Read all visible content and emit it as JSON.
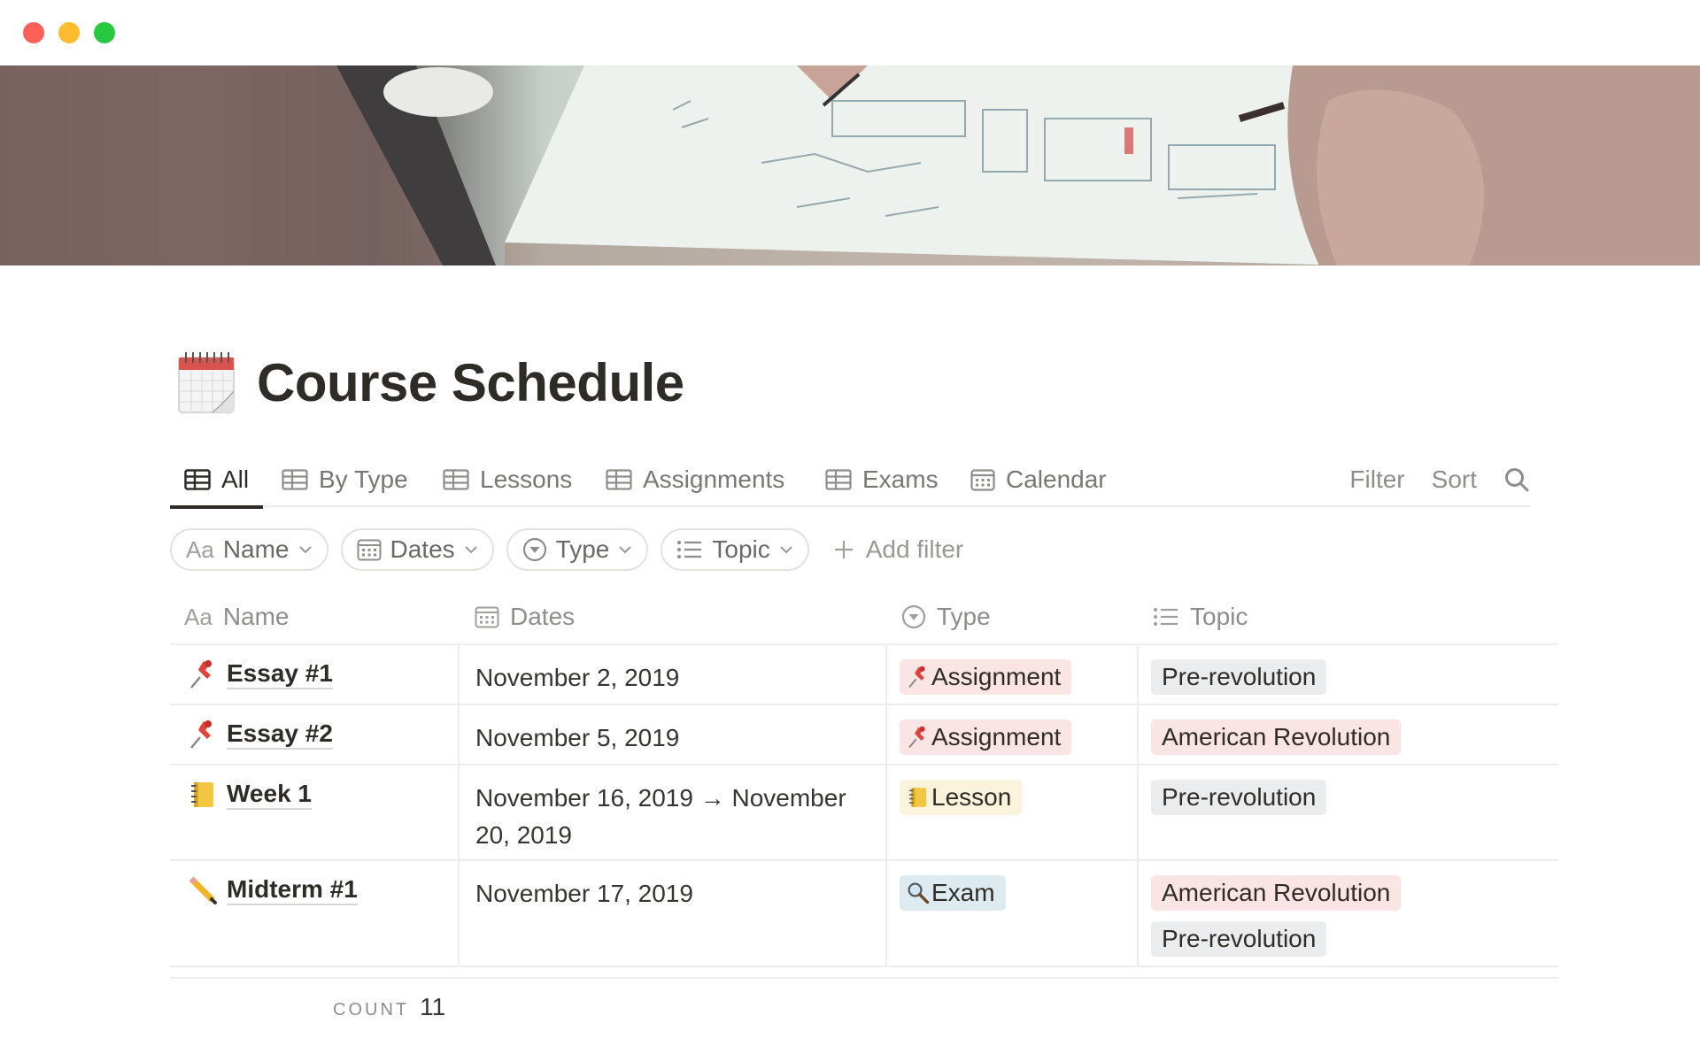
{
  "window": {
    "controls": [
      "close",
      "minimize",
      "zoom"
    ]
  },
  "page": {
    "icon": "spiral-calendar-icon",
    "title": "Course Schedule"
  },
  "tabs": [
    {
      "label": "All",
      "icon": "table-icon",
      "active": true
    },
    {
      "label": "By Type",
      "icon": "table-icon",
      "active": false
    },
    {
      "label": "Lessons",
      "icon": "table-icon",
      "active": false
    },
    {
      "label": "Assignments",
      "icon": "table-icon",
      "active": false
    },
    {
      "label": "Exams",
      "icon": "table-icon",
      "active": false
    },
    {
      "label": "Calendar",
      "icon": "calendar-icon",
      "active": false
    }
  ],
  "tools": {
    "filter": "Filter",
    "sort": "Sort",
    "search_icon": "search-icon"
  },
  "filters": [
    {
      "prefix": "Aa",
      "label": "Name"
    },
    {
      "icon": "calendar-icon",
      "label": "Dates"
    },
    {
      "icon": "select-icon",
      "label": "Type"
    },
    {
      "icon": "list-icon",
      "label": "Topic"
    }
  ],
  "add_filter": "Add filter",
  "columns": {
    "name": {
      "prefix": "Aa",
      "label": "Name"
    },
    "dates": {
      "label": "Dates"
    },
    "type": {
      "label": "Type"
    },
    "topic": {
      "label": "Topic"
    }
  },
  "rows": [
    {
      "emoji": "pushpin-icon",
      "name": "Essay #1",
      "date": "November 2, 2019",
      "type": {
        "label": "Assignment",
        "emoji": "pushpin-icon",
        "color": "#fbe4e4"
      },
      "topics": [
        {
          "label": "Pre-revolution",
          "color": "#ebeced"
        }
      ]
    },
    {
      "emoji": "pushpin-icon",
      "name": "Essay #2",
      "date": "November 5, 2019",
      "type": {
        "label": "Assignment",
        "emoji": "pushpin-icon",
        "color": "#fbe4e4"
      },
      "topics": [
        {
          "label": "American Revolution",
          "color": "#fbe4e4"
        }
      ]
    },
    {
      "emoji": "notebook-icon",
      "name": "Week 1",
      "date": "November 16, 2019 → November 20, 2019",
      "type": {
        "label": "Lesson",
        "emoji": "notebook-icon",
        "color": "#fbf3db"
      },
      "topics": [
        {
          "label": "Pre-revolution",
          "color": "#ebeced"
        }
      ]
    },
    {
      "emoji": "pencil-icon",
      "name": "Midterm #1",
      "date": "November 17, 2019",
      "type": {
        "label": "Exam",
        "emoji": "magnifier-icon",
        "color": "#ddebf1"
      },
      "topics": [
        {
          "label": "American Revolution",
          "color": "#fbe4e4"
        },
        {
          "label": "Pre-revolution",
          "color": "#ebeced"
        }
      ]
    }
  ],
  "footer": {
    "count_label": "COUNT",
    "count_value": "11"
  }
}
